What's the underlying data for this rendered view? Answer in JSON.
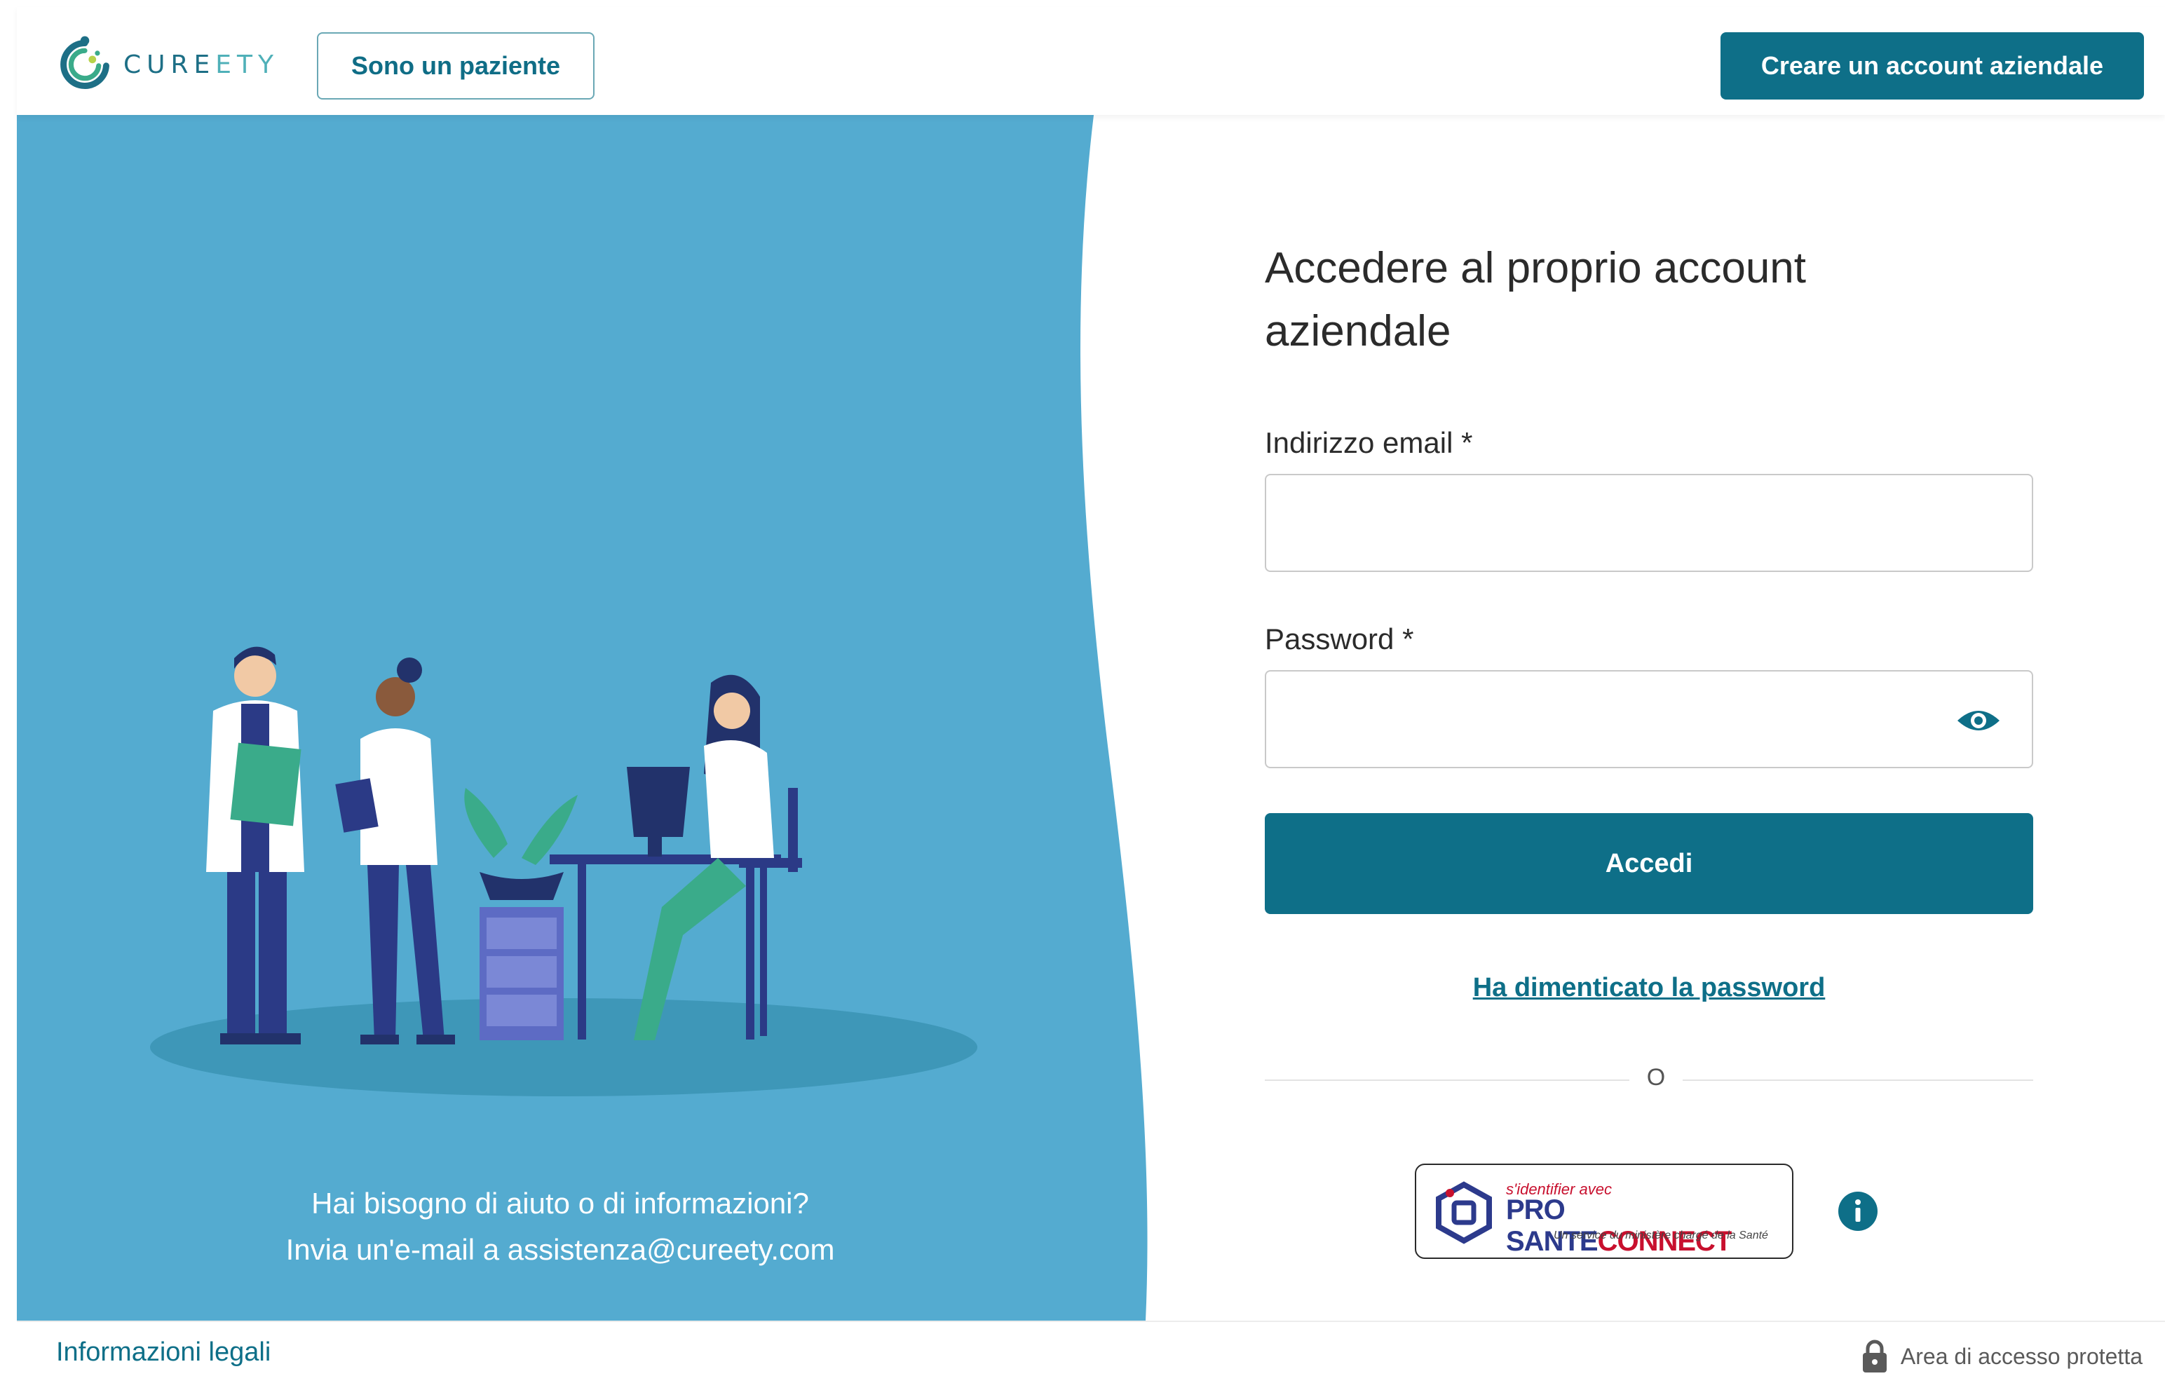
{
  "header": {
    "logo_text_dark": "CURE",
    "logo_text_light": "ETY",
    "patient_button": "Sono un paziente",
    "create_account_button": "Creare un account aziendale"
  },
  "hero": {
    "help_line1": "Hai bisogno di aiuto o di informazioni?",
    "help_line2": "Invia un'e-mail a assistenza@cureety.com"
  },
  "login": {
    "title_line1": "Accedere al proprio account",
    "title_line2": "aziendale",
    "email_label": "Indirizzo email *",
    "email_value": "",
    "password_label": "Password *",
    "password_value": "",
    "submit_label": "Accedi",
    "forgot_link": "Ha dimenticato la password",
    "divider_text": "O"
  },
  "pro_sante_connect": {
    "top_text": "s'identifier avec",
    "brand_pro": "PRO",
    "brand_sante": "SANTE",
    "brand_connect": "CONNECT",
    "subtitle": "Un service du ministère chargé de la Santé"
  },
  "footer": {
    "legal_link": "Informazioni legali",
    "secure_text": "Area di accesso protetta"
  },
  "icons": {
    "eye": "eye-icon",
    "info": "info-icon",
    "lock": "lock-icon"
  },
  "colors": {
    "primary": "#0e6f88",
    "hero_bg": "#54abd0",
    "accent_green": "#3aab8a",
    "navy": "#2b3a86"
  }
}
